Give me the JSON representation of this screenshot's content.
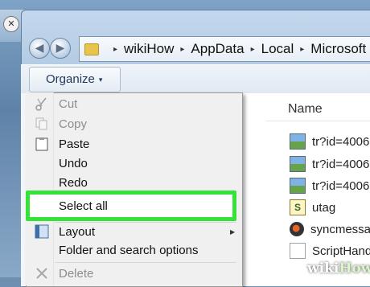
{
  "explorer": {
    "back_glyph": "◀",
    "forward_glyph": "▶",
    "breadcrumb": [
      "wikiHow",
      "AppData",
      "Local",
      "Microsoft"
    ],
    "breadcrumb_separator": "▸",
    "organize_label": "Organize",
    "organize_arrow": "▾",
    "column_header": "Name",
    "files": [
      {
        "name": "tr?id=4006",
        "icon": "image-icon"
      },
      {
        "name": "tr?id=4006",
        "icon": "image-icon"
      },
      {
        "name": "tr?id=4006",
        "icon": "image-icon"
      },
      {
        "name": "utag",
        "icon": "script-icon"
      },
      {
        "name": "syncmessa",
        "icon": "media-icon"
      },
      {
        "name": "ScriptHand",
        "icon": "document-icon"
      }
    ]
  },
  "organize_menu": {
    "items": [
      {
        "label": "Cut",
        "enabled": false
      },
      {
        "label": "Copy",
        "enabled": false
      },
      {
        "label": "Paste",
        "enabled": true
      },
      {
        "label": "Undo",
        "enabled": true
      },
      {
        "label": "Redo",
        "enabled": true
      },
      {
        "label": "Select all",
        "enabled": true,
        "highlighted": true
      },
      {
        "label": "Layout",
        "enabled": true,
        "has_submenu": true
      },
      {
        "label": "Folder and search options",
        "enabled": true
      },
      {
        "label": "Delete",
        "enabled": false
      }
    ],
    "highlight_color": "#35e23a"
  },
  "watermark": {
    "part1": "wiki",
    "part2": "How"
  }
}
